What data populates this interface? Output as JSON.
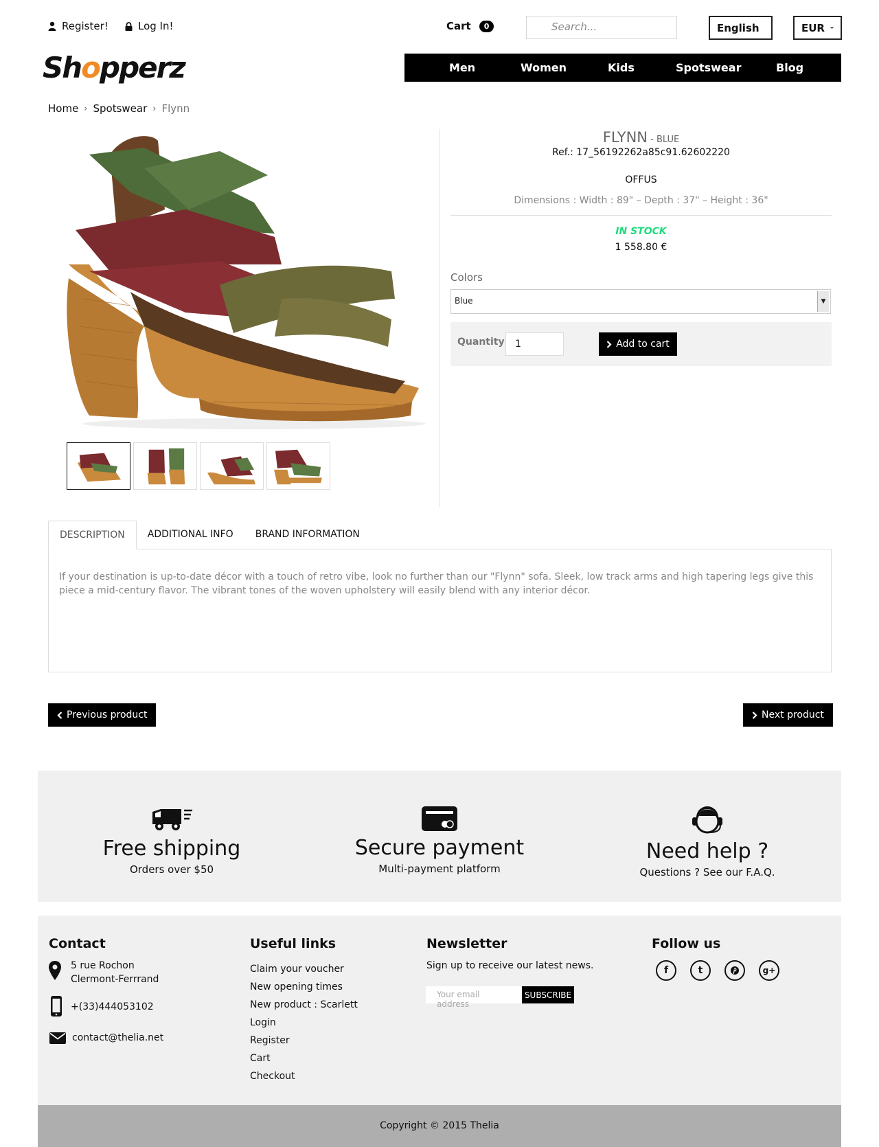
{
  "header": {
    "register_label": "Register!",
    "login_label": "Log In!",
    "cart_label": "Cart",
    "cart_count": "0",
    "search_placeholder": "Search...",
    "language": "English",
    "currency": "EUR"
  },
  "logo": {
    "pre": "Sh",
    "o": "o",
    "post": "pperz"
  },
  "nav": {
    "items": [
      {
        "label": "Men"
      },
      {
        "label": "Women"
      },
      {
        "label": "Kids"
      },
      {
        "label": "Spotswear"
      },
      {
        "label": "Blog"
      }
    ]
  },
  "breadcrumb": {
    "home": "Home",
    "category": "Spotswear",
    "current": "Flynn"
  },
  "product": {
    "name": "FLYNN",
    "variant": " - BLUE",
    "ref": "Ref.: 17_56192262a85c91.62602220",
    "brand": "OFFUS",
    "dimensions": "Dimensions : Width : 89\" – Depth : 37\" – Height : 36\"",
    "stock": "IN STOCK",
    "price": "1 558.80 €",
    "colors_label": "Colors",
    "color_value": "Blue",
    "quantity_label": "Quantity",
    "quantity_value": "1",
    "add_to_cart": "Add to cart"
  },
  "tabs": {
    "items": [
      {
        "label": "DESCRIPTION"
      },
      {
        "label": "ADDITIONAL INFO"
      },
      {
        "label": "BRAND INFORMATION"
      }
    ],
    "description": "If your destination is up-to-date décor with a touch of retro vibe, look no further than our \"Flynn\" sofa. Sleek, low track arms and high tapering legs give this piece a mid-century flavor. The vibrant tones of the woven upholstery will easily blend with any interior décor."
  },
  "pager": {
    "previous": "Previous product",
    "next": "Next product"
  },
  "features": [
    {
      "title": "Free shipping",
      "subtitle": "Orders over $50"
    },
    {
      "title": "Secure payment",
      "subtitle": "Multi-payment platform"
    },
    {
      "title": "Need help ?",
      "subtitle": "Questions ? See our F.A.Q."
    }
  ],
  "footer": {
    "contact_title": "Contact",
    "address_line1": "5 rue Rochon",
    "address_line2": "Clermont-Ferrrand",
    "phone": "+(33)444053102",
    "email": "contact@thelia.net",
    "links_title": "Useful links",
    "links": [
      {
        "label": "Claim your voucher"
      },
      {
        "label": "New opening times"
      },
      {
        "label": "New product : Scarlett"
      },
      {
        "label": "Login"
      },
      {
        "label": "Register"
      },
      {
        "label": "Cart"
      },
      {
        "label": "Checkout"
      }
    ],
    "newsletter_title": "Newsletter",
    "newsletter_text": "Sign up to receive our latest news.",
    "newsletter_placeholder": "Your email address",
    "subscribe": "SUBSCRIBE",
    "follow_title": "Follow us",
    "social": [
      {
        "icon": "facebook-icon"
      },
      {
        "icon": "tumblr-icon"
      },
      {
        "icon": "pinterest-icon"
      },
      {
        "icon": "google-plus-icon"
      }
    ],
    "copyright": "Copyright © 2015 Thelia"
  },
  "colors": {
    "accent": "#f08a24",
    "stock": "#1ddc7d",
    "nav_bg": "#000000"
  }
}
